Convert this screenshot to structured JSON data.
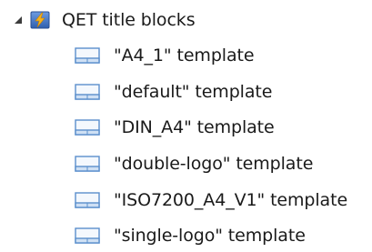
{
  "tree": {
    "root": {
      "label": "QET title blocks",
      "expanded": true,
      "icon": "lightning-folder-icon",
      "accent": "#f7b21a",
      "icon_bg": "#3a6fc4"
    },
    "children": [
      {
        "label": "\"A4_1\" template",
        "icon": "titleblock-template-icon"
      },
      {
        "label": "\"default\" template",
        "icon": "titleblock-template-icon"
      },
      {
        "label": "\"DIN_A4\" template",
        "icon": "titleblock-template-icon"
      },
      {
        "label": "\"double-logo\" template",
        "icon": "titleblock-template-icon"
      },
      {
        "label": "\"ISO7200_A4_V1\" template",
        "icon": "titleblock-template-icon"
      },
      {
        "label": "\"single-logo\" template",
        "icon": "titleblock-template-icon"
      }
    ]
  }
}
